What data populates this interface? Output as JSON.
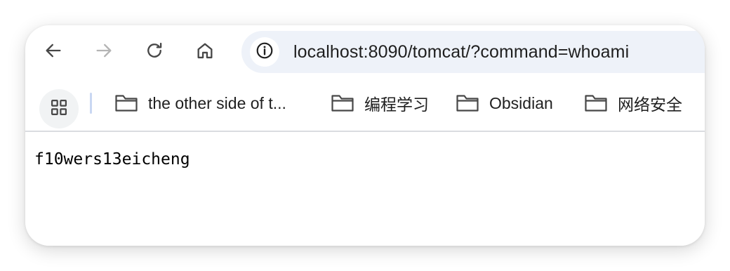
{
  "toolbar": {
    "back_icon": "arrow-left-icon",
    "forward_icon": "arrow-right-icon",
    "reload_icon": "reload-icon",
    "home_icon": "home-icon",
    "site_info_icon": "info-icon",
    "url": "localhost:8090/tomcat/?command=whoami",
    "forward_disabled": true
  },
  "bookmarks": {
    "apps_icon": "apps-grid-icon",
    "items": [
      {
        "icon": "folder-icon",
        "label": "the other side of t..."
      },
      {
        "icon": "folder-icon",
        "label": "编程学习"
      },
      {
        "icon": "folder-icon",
        "label": "Obsidian"
      },
      {
        "icon": "folder-icon",
        "label": "网络安全"
      }
    ]
  },
  "page": {
    "body_text": "f10wers13eicheng"
  },
  "colors": {
    "omnibox_bg": "#eef2f9",
    "icon_active": "#474747",
    "icon_disabled": "#b4b4b4",
    "divider_accent": "#c9d7f2"
  }
}
